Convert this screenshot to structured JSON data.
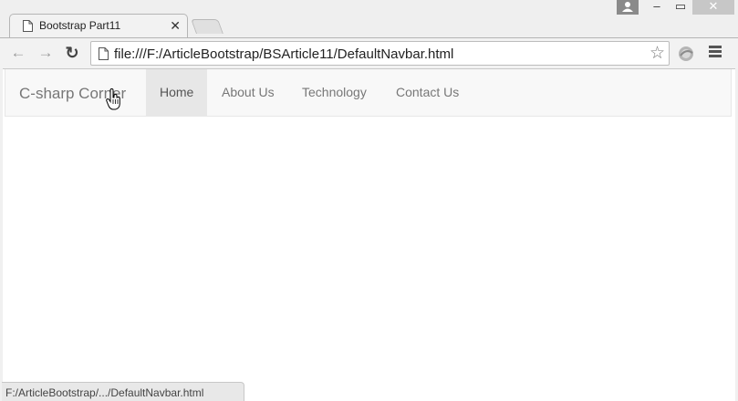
{
  "browser": {
    "tab": {
      "title": "Bootstrap Part11",
      "close_glyph": "✕",
      "icon": "page-icon"
    },
    "window_controls": {
      "minimize": "‒",
      "maximize": "▭",
      "close": "✕"
    },
    "toolbar": {
      "back_glyph": "←",
      "forward_glyph": "→",
      "reload_glyph": "↻",
      "address": "file:///F:/ArticleBootstrap/BSArticle11/DefaultNavbar.html",
      "star_glyph": "☆"
    },
    "status_text": "F:/ArticleBootstrap/.../DefaultNavbar.html"
  },
  "page": {
    "navbar": {
      "brand": "C-sharp Corner",
      "items": [
        {
          "label": "Home",
          "active": true
        },
        {
          "label": "About Us",
          "active": false
        },
        {
          "label": "Technology",
          "active": false
        },
        {
          "label": "Contact Us",
          "active": false
        }
      ]
    }
  },
  "colors": {
    "navbar_bg": "#f8f8f8",
    "active_item_bg": "#e7e7e7",
    "link_text": "#777777",
    "active_text": "#555555"
  }
}
